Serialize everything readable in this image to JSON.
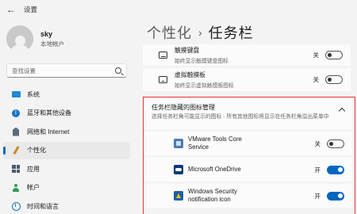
{
  "window": {
    "title": "设置",
    "back_glyph": "←"
  },
  "profile": {
    "name": "sky",
    "account_type": "本地帐户"
  },
  "search": {
    "placeholder": "查找设置"
  },
  "nav": [
    {
      "label": "系统",
      "icon": "system-icon"
    },
    {
      "label": "蓝牙和其他设备",
      "icon": "bluetooth-icon"
    },
    {
      "label": "网络和 Internet",
      "icon": "network-icon"
    },
    {
      "label": "个性化",
      "icon": "personalization-pen-icon",
      "active": true
    },
    {
      "label": "应用",
      "icon": "apps-icon"
    },
    {
      "label": "帐户",
      "icon": "account-icon"
    },
    {
      "label": "时间和语言",
      "icon": "time-language-icon"
    }
  ],
  "breadcrumb": {
    "parent": "个性化",
    "separator": "›",
    "current": "任务栏"
  },
  "taskbar_items": [
    {
      "title": "触摸键盘",
      "desc": "始终显示触摸键盘图标",
      "state": "关",
      "on": false,
      "icon": "keyboard-icon"
    },
    {
      "title": "虚拟触摸板",
      "desc": "始终显示虚拟触摸板图标",
      "state": "关",
      "on": false,
      "icon": "touchpad-icon"
    }
  ],
  "overflow_section": {
    "title": "任务栏隐藏的图标管理",
    "description": "选择任务栏角可能显示的图标 - 所有其他图标将显示在任务栏角溢出菜单中",
    "apps": [
      {
        "name": "VMware Tools Core\nService",
        "state": "关",
        "on": false,
        "icon": "vmware-icon"
      },
      {
        "name": "Microsoft OneDrive",
        "state": "开",
        "on": true,
        "icon": "onedrive-icon"
      },
      {
        "name": "Windows Security\nnotification icon",
        "state": "开",
        "on": true,
        "icon": "windows-security-icon"
      }
    ]
  },
  "colors": {
    "accent": "#0067c0",
    "highlight_border": "#e03434",
    "background": "#f3f3f3",
    "card": "#fbfbfb"
  }
}
